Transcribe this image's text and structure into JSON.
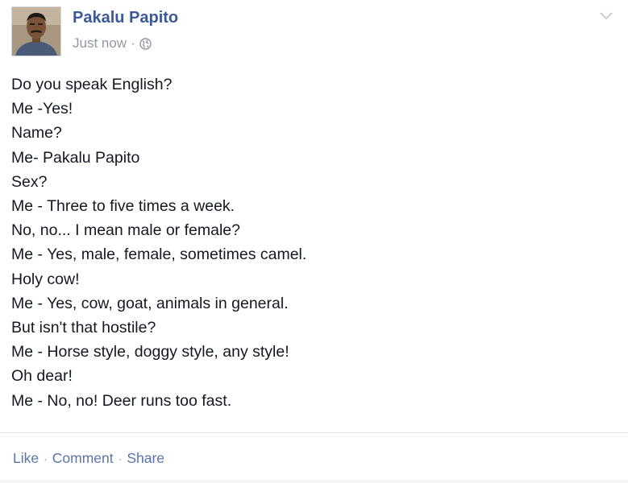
{
  "post": {
    "author": {
      "name": "Pakalu Papito"
    },
    "timestamp": "Just now",
    "meta_separator": "·",
    "privacy_icon": "globe-icon",
    "menu_icon": "chevron-down-icon",
    "body_lines": [
      "Do you speak English?",
      "Me -Yes!",
      "Name?",
      "Me- Pakalu Papito",
      "Sex?",
      "Me - Three to five times a week.",
      "No, no... I mean male or female?",
      "Me - Yes, male, female, sometimes camel.",
      "Holy cow!",
      "Me - Yes, cow, goat, animals in general.",
      "But isn't that hostile?",
      "Me - Horse style, doggy style, any style!",
      "Oh dear!",
      "Me - No, no! Deer runs too fast."
    ],
    "actions": {
      "like": "Like",
      "comment": "Comment",
      "share": "Share",
      "separator": "·"
    }
  },
  "colors": {
    "author_link": "#3b5998",
    "meta_gray": "#9197a3",
    "body_text": "#141823",
    "action_link": "#5b74a8"
  }
}
